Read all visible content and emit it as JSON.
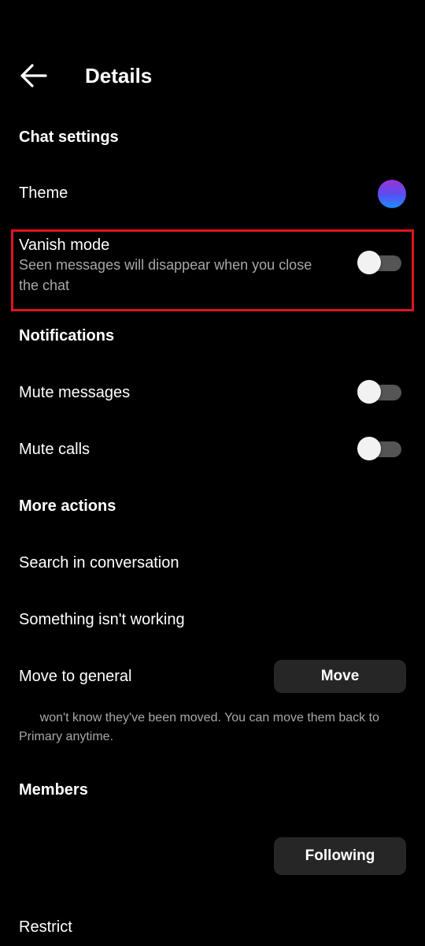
{
  "header": {
    "title": "Details",
    "back_icon": "arrow-left-icon"
  },
  "chat_settings": {
    "title": "Chat settings",
    "theme": {
      "label": "Theme",
      "swatch_colors": [
        "#9a35d6",
        "#5b4cf0",
        "#1f8cff"
      ]
    },
    "vanish_mode": {
      "label": "Vanish mode",
      "description": "Seen messages will disappear when you close the chat",
      "enabled": false
    }
  },
  "notifications": {
    "title": "Notifications",
    "mute_messages": {
      "label": "Mute messages",
      "enabled": false
    },
    "mute_calls": {
      "label": "Mute calls",
      "enabled": false
    }
  },
  "more_actions": {
    "title": "More actions",
    "search": "Search in conversation",
    "report_problem": "Something isn't working",
    "move_to_general": {
      "label": "Move to general",
      "button": "Move",
      "info": "      won't know they've been moved. You can move them back to Primary anytime."
    }
  },
  "members": {
    "title": "Members",
    "follow_button": "Following",
    "restrict": "Restrict"
  },
  "colors": {
    "background": "#000000",
    "text": "#ffffff",
    "secondary_text": "#a8a8a8",
    "button_bg": "#262626",
    "toggle_track": "#555555",
    "highlight": "#e0141e"
  }
}
